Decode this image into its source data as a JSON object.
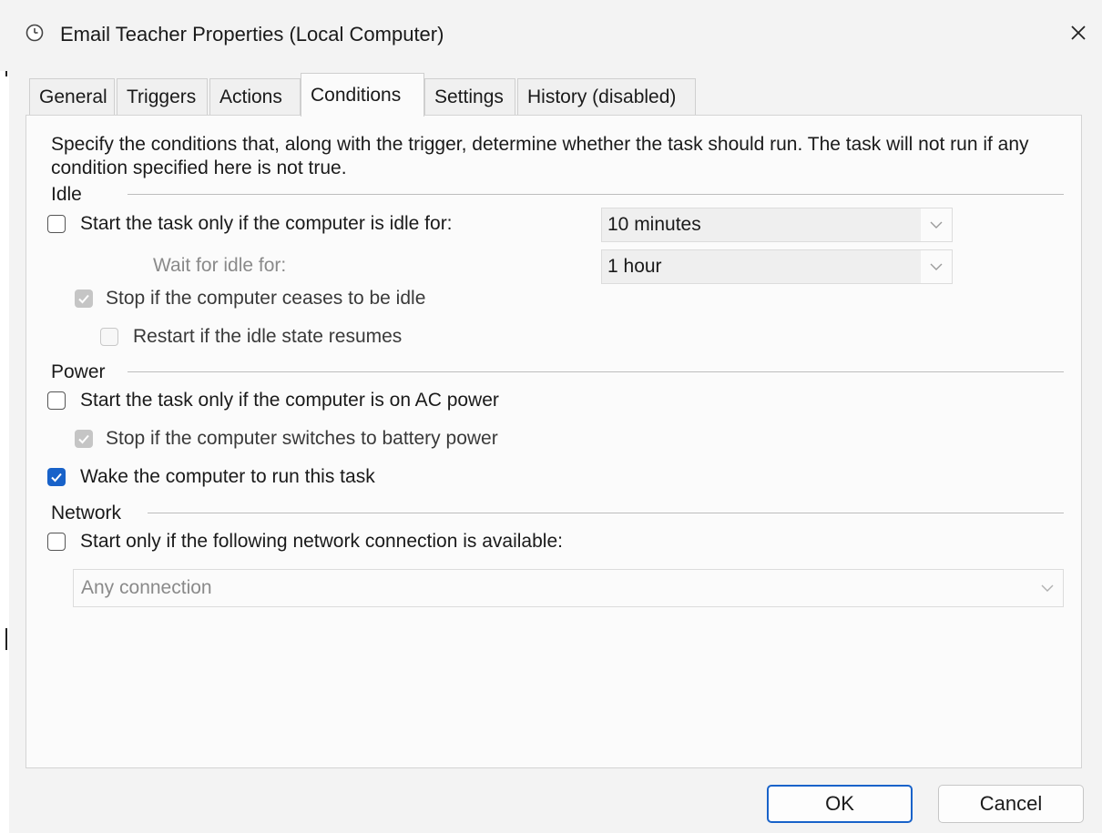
{
  "window": {
    "title": "Email Teacher Properties (Local Computer)",
    "icon": "clock-icon",
    "close_icon": "close-icon"
  },
  "tabs": [
    {
      "label": "General",
      "active": false
    },
    {
      "label": "Triggers",
      "active": false
    },
    {
      "label": "Actions",
      "active": false
    },
    {
      "label": "Conditions",
      "active": true
    },
    {
      "label": "Settings",
      "active": false
    },
    {
      "label": "History (disabled)",
      "active": false
    }
  ],
  "conditions": {
    "intro": "Specify the conditions that, along with the trigger, determine whether the task should run.  The task will not run  if any condition specified here is not true.",
    "idle": {
      "label": "Idle",
      "start_if_idle": {
        "label": "Start the task only if the computer is idle for:",
        "checked": false
      },
      "idle_duration": {
        "value": "10 minutes"
      },
      "wait_label": "Wait for idle for:",
      "wait_duration": {
        "value": "1 hour"
      },
      "stop_if_ceases": {
        "label": "Stop if the computer ceases to be idle",
        "checked": true,
        "enabled": false
      },
      "restart_if_resumes": {
        "label": "Restart if the idle state resumes",
        "checked": false,
        "enabled": false
      }
    },
    "power": {
      "label": "Power",
      "ac_power": {
        "label": "Start the task only if the computer is on AC power",
        "checked": false
      },
      "battery_stop": {
        "label": "Stop if the computer switches to battery power",
        "checked": true,
        "enabled": false
      },
      "wake": {
        "label": "Wake the computer to run this task",
        "checked": true
      }
    },
    "network": {
      "label": "Network",
      "start_only_if": {
        "label": "Start only if the following network connection is available:",
        "checked": false
      },
      "connection": {
        "value": "Any connection"
      }
    }
  },
  "buttons": {
    "ok": "OK",
    "cancel": "Cancel"
  },
  "colors": {
    "accent": "#1862c9",
    "disabled_text": "#8a8a8a"
  }
}
